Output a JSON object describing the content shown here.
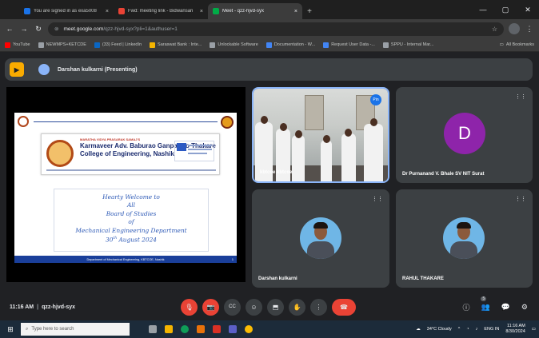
{
  "browser": {
    "tabs": [
      {
        "title": "You are signed in as exa5008",
        "color": "#1a73e8",
        "active": false
      },
      {
        "title": "Fwd: meeting link - Bidwansari",
        "color": "#ea4335",
        "active": false
      },
      {
        "title": "Meet - qzz-hjvd-syx",
        "color": "#00ac47",
        "active": true
      }
    ],
    "close_glyph": "×",
    "new_tab_glyph": "+",
    "window_controls": [
      "—",
      "▢",
      "✕"
    ],
    "url_host": "meet.google.com",
    "url_path": "/qzz-hjvd-syx?pli=1&authuser=1",
    "bookmarks": [
      {
        "label": "YouTube",
        "color": "#ff0000"
      },
      {
        "label": "NEWMPS+KETCDE",
        "color": "#9aa0a6"
      },
      {
        "label": "(33) Feed | LinkedIn",
        "color": "#0a66c2"
      },
      {
        "label": "Saraswat Bank : Inte...",
        "color": "#f4b400"
      },
      {
        "label": "Unlockable Software",
        "color": "#9aa0a6"
      },
      {
        "label": "Documentation - W...",
        "color": "#4285f4"
      },
      {
        "label": "Request User Data -...",
        "color": "#4285f4"
      },
      {
        "label": "SPPU - Internal Mar...",
        "color": "#9aa0a6"
      }
    ],
    "all_bookmarks": "All Bookmarks"
  },
  "meet": {
    "presenter_banner": "Darshan kulkarni (Presenting)",
    "slide": {
      "college_small": "MARATHA VIDYA PRASARAK SAMAJ'S",
      "college_name_1": "Karmaveer Adv. Baburao Ganpatrao Thakare",
      "college_name_2": "College of Engineering, Nashik",
      "welcome_lines": [
        "Hearty Welcome to",
        "All",
        "Board of Studies",
        "of",
        "Mechanical Engineering Department"
      ],
      "date_day": "30",
      "date_suffix": "th",
      "date_rest": " August 2024",
      "footer": "Department of Mechanical Engineering, KBTCOE, Nashik",
      "page": "1"
    },
    "tiles": [
      {
        "name": "kbtcoe kbtcoe",
        "type": "video",
        "pin": "Pin"
      },
      {
        "name": "Dr Purnanand V. Bhale SV NIT Surat",
        "type": "letter",
        "letter": "D",
        "color": "#8e24aa"
      },
      {
        "name": "Darshan kulkarni",
        "type": "photo"
      },
      {
        "name": "RAHUL THAKARE",
        "type": "photo"
      }
    ],
    "time": "11:16 AM",
    "separator": "|",
    "meeting_code": "qzz-hjvd-syx",
    "participants_count": "5",
    "controls": [
      "mic-off",
      "camera-off",
      "captions",
      "emoji",
      "present",
      "raise-hand",
      "more",
      "end-call"
    ],
    "control_glyphs": {
      "mic": "🎙",
      "cam": "📷",
      "cc": "CC",
      "emoji": "☺",
      "present": "⬒",
      "hand": "✋",
      "more": "⋮",
      "end": "☎",
      "info": "ⓘ",
      "people": "👥",
      "chat": "💬",
      "activities": "⚙"
    }
  },
  "taskbar": {
    "search_placeholder": "Type here to search",
    "weather": "34°C Cloudy",
    "lang": "ENG IN",
    "time": "11:16 AM",
    "date": "8/30/2024",
    "win_glyph": "⊞",
    "search_glyph": "⌕"
  }
}
